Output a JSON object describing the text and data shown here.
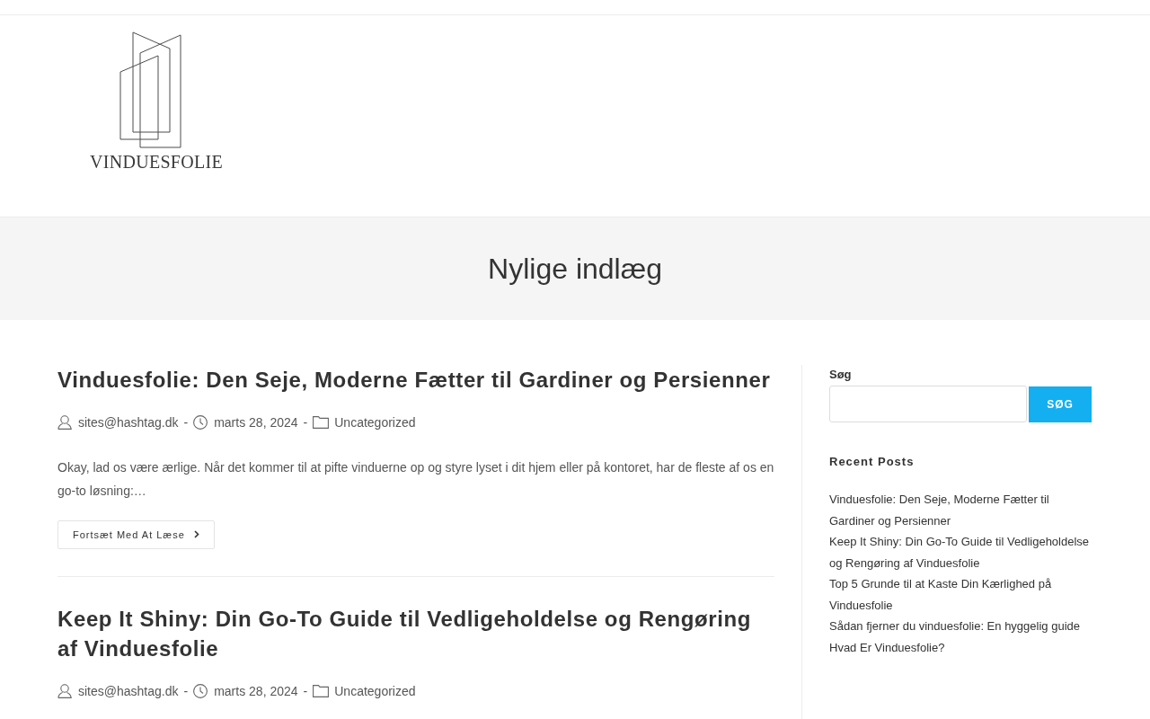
{
  "logo": {
    "text": "VINDUESFOLIE"
  },
  "page_header": {
    "title": "Nylige indlæg"
  },
  "posts": [
    {
      "title": "Vinduesfolie: Den Seje, Moderne Fætter til Gardiner og Persienner",
      "meta": [
        {
          "kind": "author",
          "text": "sites@hashtag.dk"
        },
        {
          "kind": "separator",
          "text": "-"
        },
        {
          "kind": "date",
          "text": "marts 28, 2024"
        },
        {
          "kind": "separator",
          "text": "-"
        },
        {
          "kind": "category",
          "text": "Uncategorized"
        }
      ],
      "excerpt": "Okay, lad os være ærlige. Når det kommer til at pifte vinduerne op og styre lyset i dit hjem eller på kontoret, har de fleste af os en go-to løsning:…",
      "read_more": "Fortsæt Med At Læse"
    },
    {
      "title": "Keep It Shiny: Din Go-To Guide til Vedligeholdelse og Rengøring af Vinduesfolie",
      "meta": [
        {
          "kind": "author",
          "text": "sites@hashtag.dk"
        },
        {
          "kind": "separator",
          "text": "-"
        },
        {
          "kind": "date",
          "text": "marts 28, 2024"
        },
        {
          "kind": "separator",
          "text": "-"
        },
        {
          "kind": "category",
          "text": "Uncategorized"
        }
      ]
    }
  ],
  "sidebar": {
    "search": {
      "label": "Søg",
      "button": "SØG"
    },
    "recent_posts": {
      "title": "Recent Posts",
      "items": [
        "Vinduesfolie: Den Seje, Moderne Fætter til Gardiner og Persienner",
        "Keep It Shiny: Din Go-To Guide til Vedligeholdelse og Rengøring af Vinduesfolie",
        "Top 5 Grunde til at Kaste Din Kærlighed på Vinduesfolie",
        "Sådan fjerner du vinduesfolie: En hyggelig guide",
        "Hvad Er Vinduesfolie?"
      ]
    }
  }
}
